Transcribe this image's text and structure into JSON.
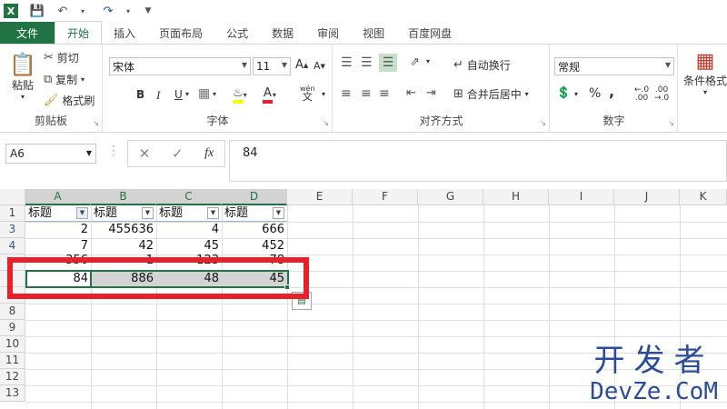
{
  "quick_access": {
    "logo": "X",
    "icons": [
      "save-icon",
      "undo-icon",
      "redo-icon",
      "customize-icon"
    ]
  },
  "tabs": [
    "文件",
    "开始",
    "插入",
    "页面布局",
    "公式",
    "数据",
    "审阅",
    "视图",
    "百度网盘"
  ],
  "ribbon": {
    "clipboard": {
      "paste": "粘贴",
      "cut": "剪切",
      "copy": "复制",
      "format_painter": "格式刷",
      "label": "剪贴板"
    },
    "font": {
      "name": "宋体",
      "size": "11",
      "label": "字体",
      "bold": "B",
      "italic": "I",
      "underline": "U",
      "phonetic": "wén",
      "grow": "A",
      "shrink": "A"
    },
    "alignment": {
      "wrap": "自动换行",
      "merge": "合并后居中",
      "label": "对齐方式"
    },
    "number": {
      "format": "常规",
      "percent": "%",
      "comma": ",",
      "label": "数字"
    },
    "styles": {
      "conditional": "条件格式"
    }
  },
  "formula_bar": {
    "name_box": "A6",
    "fx": "fx",
    "value": "84"
  },
  "grid": {
    "columns": [
      "A",
      "B",
      "C",
      "D",
      "E",
      "F",
      "G",
      "H",
      "I",
      "J",
      "K"
    ],
    "row_numbers": [
      "1",
      "3",
      "4",
      "",
      "",
      "8",
      "9",
      "10",
      "11",
      "12",
      "13"
    ],
    "header_row": [
      "标题",
      "标题",
      "标题",
      "标题"
    ],
    "rows": [
      [
        "2",
        "455636",
        "4",
        "666"
      ],
      [
        "7",
        "42",
        "45",
        "452"
      ],
      [
        "356",
        "1",
        "123",
        "78"
      ],
      [
        "84",
        "886",
        "48",
        "45"
      ]
    ]
  },
  "watermark": {
    "cn": "开发者",
    "en": "DevZe.CoM"
  }
}
